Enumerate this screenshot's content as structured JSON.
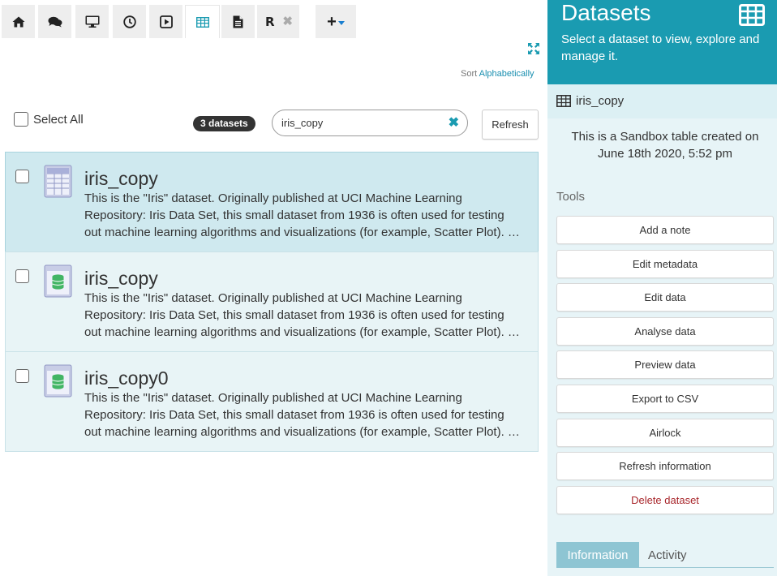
{
  "tabs": {
    "r_label": "R",
    "r_close": "✖",
    "add": "+"
  },
  "sort": {
    "label": "Sort",
    "value": "Alphabetically"
  },
  "controls": {
    "select_all": "Select All",
    "count": "3 datasets",
    "search_value": "iris_copy",
    "clear": "✖",
    "refresh": "Refresh"
  },
  "datasets": [
    {
      "name": "iris_copy",
      "icon": "table-icon",
      "desc": "This is the \"Iris\" dataset. Originally published at UCI Machine Learning Repository: Iris Data Set, this small dataset from 1936 is often used for testing out machine learning algorithms and visualizations (for example, Scatter Plot). …"
    },
    {
      "name": "iris_copy",
      "icon": "database-icon",
      "desc": "This is the \"Iris\" dataset. Originally published at UCI Machine Learning Repository: Iris Data Set, this small dataset from 1936 is often used for testing out machine learning algorithms and visualizations (for example, Scatter Plot). …"
    },
    {
      "name": "iris_copy0",
      "icon": "database-icon",
      "desc": "This is the \"Iris\" dataset. Originally published at UCI Machine Learning Repository: Iris Data Set, this small dataset from 1936 is often used for testing out machine learning algorithms and visualizations (for example, Scatter Plot). …"
    }
  ],
  "panel": {
    "title": "Datasets",
    "subtitle": "Select a dataset to view, explore and manage it.",
    "selected_name": "iris_copy",
    "created": "This is a Sandbox table created on June 18th 2020, 5:52 pm",
    "tools_label": "Tools",
    "tools": [
      "Add a note",
      "Edit metadata",
      "Edit data",
      "Analyse data",
      "Preview data",
      "Export to CSV",
      "Airlock",
      "Refresh information",
      "Delete dataset"
    ],
    "tab_information": "Information",
    "tab_activity": "Activity"
  },
  "colors": {
    "accent": "#1a9bb1",
    "panel_bg": "#e7f4f7",
    "danger": "#a8262b",
    "selected_row": "#cfe9ef"
  }
}
